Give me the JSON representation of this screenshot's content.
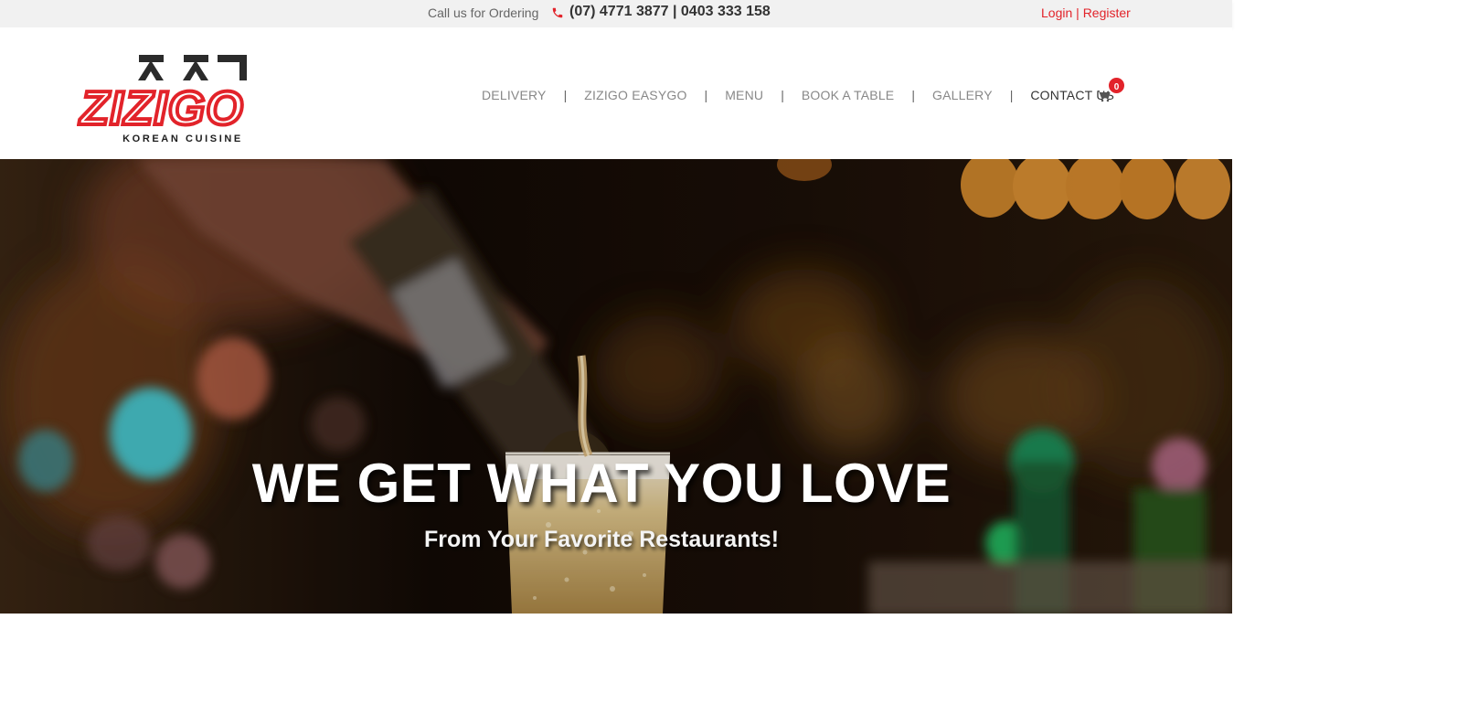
{
  "topbar": {
    "call_label": "Call us for Ordering",
    "phone_numbers": "(07) 4771 3877 | 0403 333 158",
    "login": "Login",
    "divider": "|",
    "register": "Register"
  },
  "logo": {
    "brand": "ZIZIGO",
    "tagline": "KOREAN CUISINE"
  },
  "nav": {
    "items": [
      "DELIVERY",
      "ZIZIGO EASYGO",
      "MENU",
      "BOOK A TABLE",
      "GALLERY",
      "CONTACT US"
    ],
    "separator": "|",
    "active": "CONTACT US"
  },
  "cart": {
    "count": "0"
  },
  "hero": {
    "title": "WE GET WHAT YOU LOVE",
    "subtitle": "From Your Favorite Restaurants!"
  },
  "colors": {
    "accent": "#e2232a",
    "topbar_bg": "#f1f1f1",
    "nav_text": "#888888",
    "nav_active": "#333333"
  },
  "icons": {
    "phone": "phone-icon",
    "cart": "cart-icon"
  }
}
